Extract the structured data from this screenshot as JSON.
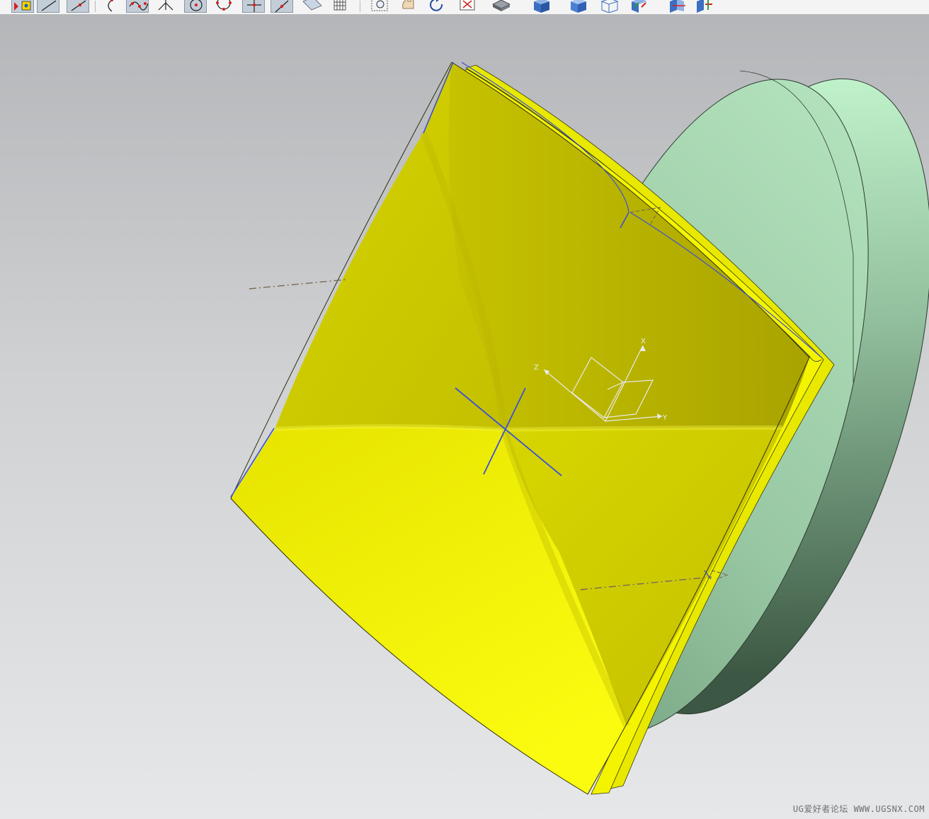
{
  "toolbar": {
    "buttons": [
      {
        "name": "selection-filter-icon",
        "active": true
      },
      {
        "name": "line-icon",
        "active": true
      },
      {
        "name": "point-line-icon",
        "active": true
      },
      {
        "name": "arc-icon",
        "active": false
      },
      {
        "name": "spline-through-points-icon",
        "active": true
      },
      {
        "name": "intersection-icon",
        "active": false
      },
      {
        "name": "circle-center-icon",
        "active": true
      },
      {
        "name": "circle-points-icon",
        "active": false
      },
      {
        "name": "point-icon",
        "active": true
      },
      {
        "name": "tangent-point-icon",
        "active": true
      },
      {
        "name": "extruded-surface-icon",
        "active": false
      },
      {
        "name": "mesh-surface-icon",
        "active": false
      },
      {
        "name": "zoom-window-icon",
        "active": false
      },
      {
        "name": "pan-hand-icon",
        "active": false
      },
      {
        "name": "rotate-view-icon",
        "active": false
      },
      {
        "name": "fit-view-icon",
        "active": false
      },
      {
        "name": "render-style-icon",
        "active": false
      },
      {
        "name": "shaded-with-edges-icon",
        "active": false
      },
      {
        "name": "shaded-icon",
        "active": false
      },
      {
        "name": "wireframe-icon",
        "active": false
      },
      {
        "name": "view-orientation-icon",
        "active": false
      },
      {
        "name": "section-view-icon",
        "active": false
      },
      {
        "name": "move-object-icon",
        "active": false
      }
    ]
  },
  "triad": {
    "x_label": "X",
    "y_label": "Y",
    "z_label": "Z"
  },
  "colors": {
    "sheet_yellow": "#eded00",
    "sheet_olive": "#b5b000",
    "disk_green": "#a8dab4",
    "disk_dark_green": "#3e5a46",
    "edge_blue": "#3b4fd8",
    "axis_brown": "#7a6a58"
  },
  "watermark": {
    "text": "UG爱好者论坛 WWW.UGSNX.COM"
  }
}
